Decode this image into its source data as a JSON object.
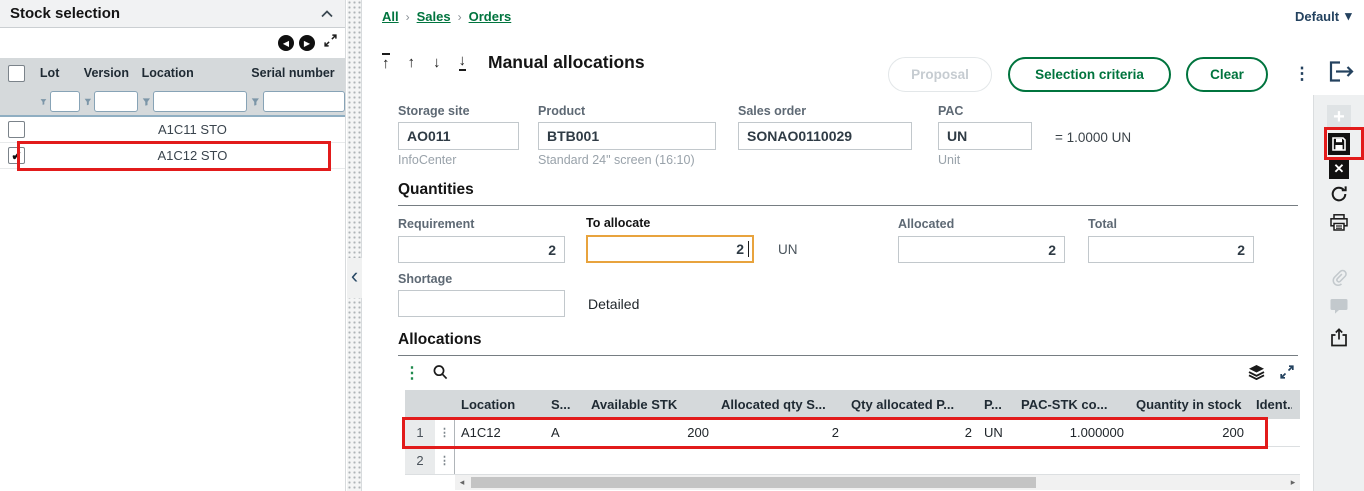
{
  "stock_selection": {
    "title": "Stock selection",
    "columns": {
      "lot": "Lot",
      "version": "Version",
      "location": "Location",
      "serial": "Serial number"
    },
    "rows": [
      {
        "lot": "",
        "version": "",
        "location": "A1C11 STO",
        "serial": ""
      },
      {
        "lot": "",
        "version": "",
        "location": "A1C12 STO",
        "serial": ""
      }
    ]
  },
  "breadcrumb": {
    "items": [
      "All",
      "Sales",
      "Orders"
    ],
    "separator": "›"
  },
  "header": {
    "title": "Manual allocations",
    "profile": "Default",
    "proposal_label": "Proposal",
    "selection_criteria_label": "Selection criteria",
    "clear_label": "Clear"
  },
  "form": {
    "storage_site": {
      "label": "Storage site",
      "value": "AO011",
      "help": "InfoCenter"
    },
    "product": {
      "label": "Product",
      "value": "BTB001",
      "help": "Standard 24\" screen (16:10)"
    },
    "sales_order": {
      "label": "Sales order",
      "value": "SONAO0110029"
    },
    "pac": {
      "label": "PAC",
      "value": "UN",
      "help": "Unit"
    },
    "conversion": "= 1.0000 UN"
  },
  "quantities": {
    "title": "Quantities",
    "requirement": {
      "label": "Requirement",
      "value": "2"
    },
    "to_allocate": {
      "label": "To allocate",
      "value": "2",
      "unit": "UN"
    },
    "allocated": {
      "label": "Allocated",
      "value": "2"
    },
    "total": {
      "label": "Total",
      "value": "2"
    },
    "shortage": {
      "label": "Shortage",
      "value": ""
    },
    "detailed_label": "Detailed"
  },
  "allocations": {
    "title": "Allocations",
    "columns": [
      "Location",
      "S...",
      "Available STK",
      "Allocated qty S...",
      "Qty allocated P...",
      "P...",
      "PAC-STK co...",
      "Quantity in stock",
      "Ident..."
    ],
    "rows": [
      {
        "num": "1",
        "location": "A1C12",
        "s": "A",
        "available_stk": "200",
        "allocated_qty_s": "2",
        "qty_allocated_p": "2",
        "p": "UN",
        "pac_stk_co": "1.000000",
        "qty_in_stock": "200",
        "ident": ""
      },
      {
        "num": "2",
        "location": "",
        "s": "",
        "available_stk": "",
        "allocated_qty_s": "",
        "qty_allocated_p": "",
        "p": "",
        "pac_stk_co": "",
        "qty_in_stock": "",
        "ident": ""
      }
    ]
  },
  "icons": {
    "check": "✔",
    "prev": "◀",
    "next": "▶",
    "caret_down": "▾",
    "up": "↑",
    "down": "↓",
    "kebab": "⋮",
    "plus": "+",
    "close": "✕",
    "scroll_left": "◂",
    "scroll_right": "▸",
    "chevron_left": "‹"
  },
  "colors": {
    "accent_green": "#00743E",
    "navy": "#24425F",
    "focus_orange": "#E8A33D",
    "annotation_red": "#E21B1B"
  }
}
